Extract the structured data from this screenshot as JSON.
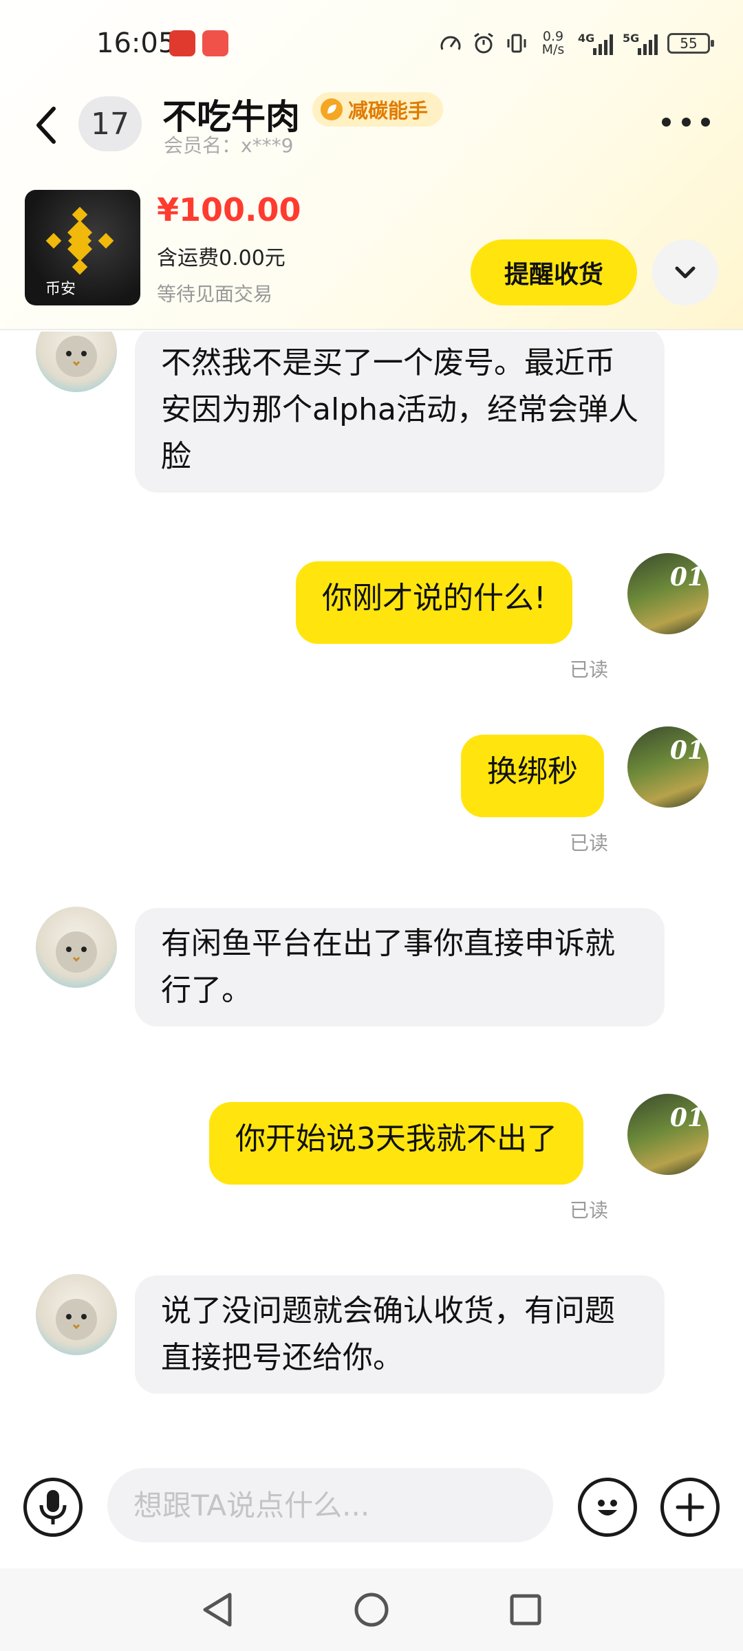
{
  "status_bar": {
    "time": "16:05",
    "net_speed_value": "0.9",
    "net_speed_unit": "M/s",
    "sim1_label": "4G",
    "sim2_label": "5G",
    "battery": "55"
  },
  "header": {
    "unread_count": "17",
    "contact_name": "不吃牛肉",
    "badge": "减碳能手",
    "member": "会员名：x***9"
  },
  "product": {
    "thumb_label": "币安",
    "price": "¥100.00",
    "shipping": "含运费0.00元",
    "status": "等待见面交易",
    "action_button": "提醒收货"
  },
  "messages": [
    {
      "from": "other",
      "text": "不然我不是买了一个废号。最近币安因为那个alpha活动，经常会弹人脸"
    },
    {
      "from": "me",
      "text": "你刚才说的什么!",
      "status": "已读"
    },
    {
      "from": "me",
      "text": "换绑秒",
      "status": "已读"
    },
    {
      "from": "other",
      "text": "有闲鱼平台在出了事你直接申诉就行了。"
    },
    {
      "from": "me",
      "text": "你开始说3天我就不出了",
      "status": "已读"
    },
    {
      "from": "other",
      "text": "说了没问题就会确认收货，有问题直接把号还给你。"
    }
  ],
  "my_avatar_tag": "01",
  "input": {
    "placeholder": "想跟TA说点什么..."
  },
  "colors": {
    "accent_yellow": "#ffe50d",
    "price_red": "#ff3b30",
    "badge_orange": "#e07b00"
  },
  "icons": {
    "back": "chevron-left-icon",
    "more": "more-dots-icon",
    "expand": "chevron-down-icon",
    "voice": "microphone-icon",
    "emoji": "emoji-icon",
    "add": "plus-circle-icon"
  }
}
